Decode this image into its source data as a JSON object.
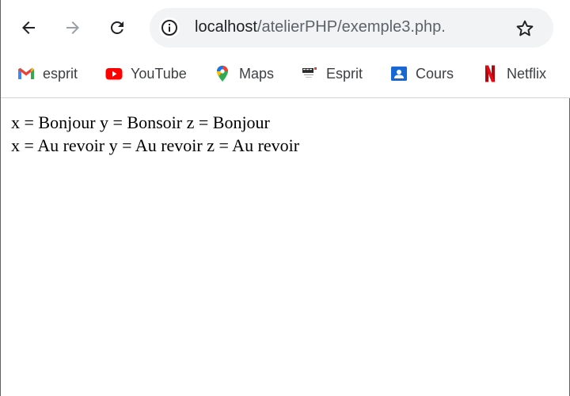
{
  "address_bar": {
    "host": "localhost",
    "path": "/atelierPHP/exemple3.php."
  },
  "bookmarks": [
    {
      "label": "esprit",
      "icon": "gmail-icon"
    },
    {
      "label": "YouTube",
      "icon": "youtube-icon"
    },
    {
      "label": "Maps",
      "icon": "maps-icon"
    },
    {
      "label": "Esprit",
      "icon": "esprit-logo-icon"
    },
    {
      "label": "Cours",
      "icon": "classroom-icon"
    },
    {
      "label": "Netflix",
      "icon": "netflix-icon"
    }
  ],
  "page": {
    "lines": [
      "x = Bonjour y = Bonsoir z = Bonjour",
      "x = Au revoir y = Au revoir z = Au revoir"
    ]
  },
  "colors": {
    "toolbar_icon": "#202124",
    "disabled_icon": "#9aa0a6",
    "omnibox_bg": "#f1f3f4",
    "youtube_red": "#ff0000",
    "netflix_red": "#e50914",
    "classroom_blue": "#1967d2"
  }
}
